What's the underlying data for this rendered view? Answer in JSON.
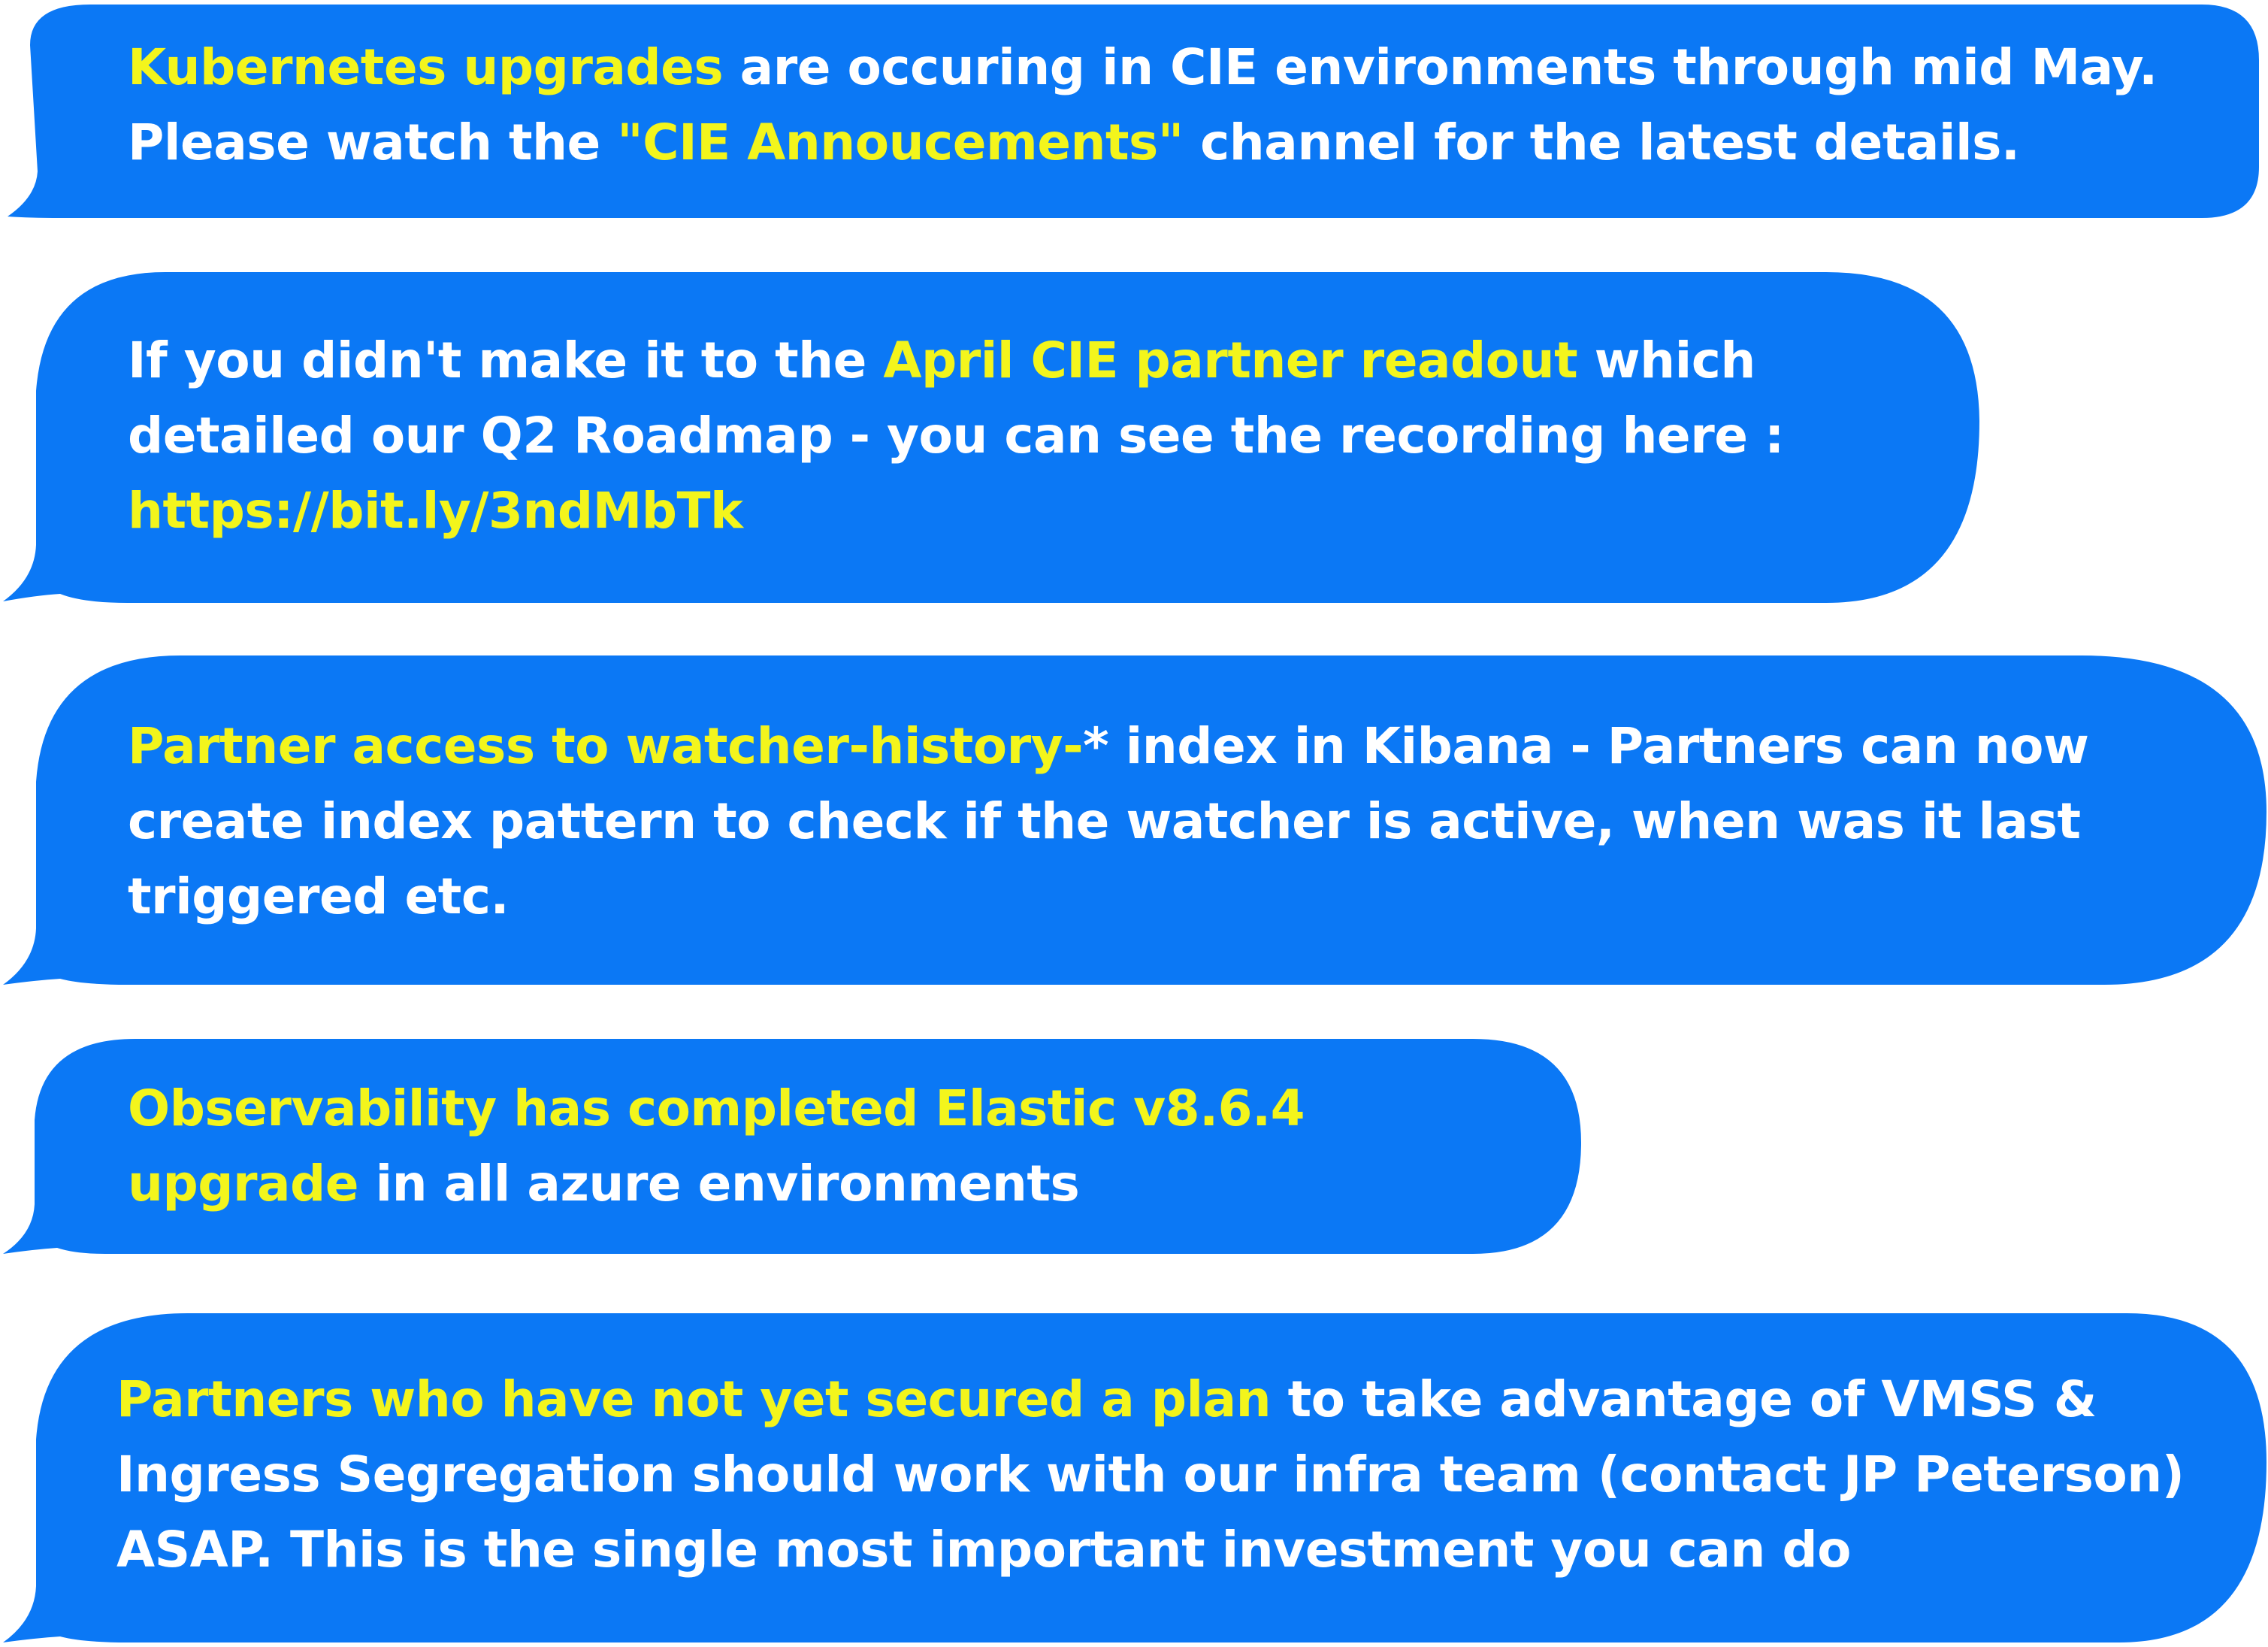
{
  "theme": {
    "bubble_color": "#0b78f5",
    "text_color": "#ffffff",
    "highlight_color": "#f3f51c"
  },
  "messages": [
    {
      "line1_highlight": "Kubernetes upgrades",
      "line1_rest": " are occuring in CIE environments through mid May.",
      "line2_before": "Please watch the ",
      "line2_highlight": "\"CIE Annoucements\"",
      "line2_rest": " channel for the latest details."
    },
    {
      "line1_before": " If you didn't make it to the ",
      "line1_highlight": "April CIE partner readout",
      "line1_rest": " which",
      "line2": "detailed our Q2 Roadmap - you can see the recording here :",
      "link": "https://bit.ly/3ndMbTk"
    },
    {
      "line1_highlight": "Partner access to watcher-history-",
      "line1_rest": "* index in Kibana - Partners can now",
      "line2": "create index pattern to check if the watcher is active, when was it last",
      "line3": "triggered etc."
    },
    {
      "line1_highlight": "Observability has completed Elastic v8.6.4",
      "line2_highlight": "upgrade",
      "line2_rest": " in all azure environments"
    },
    {
      "line1_highlight": "Partners who have not yet secured a plan",
      "line1_rest": " to take advantage of VMSS &",
      "line2": "Ingress Segregation should work with our infra team (contact JP Peterson)",
      "line3": "ASAP. This is the single most important investment you can do"
    }
  ]
}
